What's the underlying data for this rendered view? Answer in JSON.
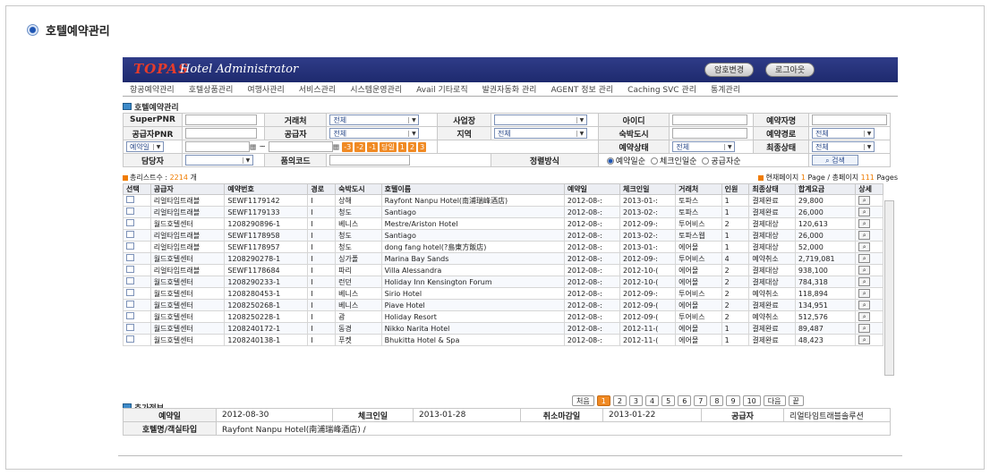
{
  "page": {
    "title": "호텔예약관리"
  },
  "banner": {
    "logo": "TOPAS",
    "subtitle": "Hotel Administrator",
    "change_password": "암호변경",
    "logout": "로그아웃"
  },
  "nav": [
    "항공예약관리",
    "호텔상품관리",
    "여행사관리",
    "서비스관리",
    "시스템운영관리",
    "Avail 기타로직",
    "발권자동화 관리",
    "AGENT 정보 관리",
    "Caching SVC 관리",
    "통계관리"
  ],
  "search": {
    "section_title": "호텔예약관리",
    "superpnr": "SuperPNR",
    "account": "거래처",
    "account_val": "전체",
    "business": "사업장",
    "user_id": "아이디",
    "booker": "예약자명",
    "supplier_pnr": "공급자PNR",
    "supplier": "공급자",
    "supplier_val": "전체",
    "region": "지역",
    "region_val": "전체",
    "city": "숙박도시",
    "route": "예약경로",
    "route_val": "전체",
    "date_type": "예약일",
    "tilde": "~",
    "quick": [
      "-3",
      "-2",
      "-1",
      "당일",
      "1",
      "2",
      "3"
    ],
    "status": "예약상태",
    "status_val": "전체",
    "final_status": "최종상태",
    "final_status_val": "전체",
    "manager": "담당자",
    "item_code": "품의코드",
    "sort": "정렬방식",
    "sort_options": [
      "예약일순",
      "체크인일순",
      "공급자순"
    ],
    "search_btn": "검색"
  },
  "list": {
    "count_label": "총리스트수 :",
    "count": "2214",
    "count_unit": "개",
    "page_label": "현재페이지",
    "page_cur": "1",
    "page_total_label": "Page / 총페이지",
    "page_total": "111",
    "pages_word": "Pages",
    "columns": [
      "선택",
      "공급자",
      "예약번호",
      "경로",
      "숙박도시",
      "호텔이름",
      "예약일",
      "체크인일",
      "거래처",
      "인원",
      "최종상태",
      "합계요금",
      "상세"
    ],
    "rows": [
      [
        "리얼타임트래블",
        "SEWF1179142",
        "I",
        "상해",
        "Rayfont Nanpu Hotel(南浦瑞峰酒店)",
        "2012-08-:",
        "2013-01-:",
        "토파스",
        "1",
        "결제완료",
        "29,800"
      ],
      [
        "리얼타임트래블",
        "SEWF1179133",
        "I",
        "청도",
        "Santiago",
        "2012-08-:",
        "2013-02-:",
        "토파스",
        "1",
        "결제완료",
        "26,000"
      ],
      [
        "월드호텔센터",
        "1208290896-1",
        "I",
        "베니스",
        "Mestre/Ariston Hotel",
        "2012-08-:",
        "2012-09-:",
        "투어비스",
        "2",
        "결제대상",
        "120,613"
      ],
      [
        "리얼타임트래블",
        "SEWF1178958",
        "I",
        "청도",
        "Santiago",
        "2012-08-:",
        "2013-02-:",
        "토파스웹",
        "1",
        "결제대상",
        "26,000"
      ],
      [
        "리얼타임트래블",
        "SEWF1178957",
        "I",
        "청도",
        "dong fang hotel(?島東方飯店)",
        "2012-08-:",
        "2013-01-:",
        "에어몰",
        "1",
        "결제대상",
        "52,000"
      ],
      [
        "월드호텔센터",
        "1208290278-1",
        "I",
        "싱가폴",
        "Marina Bay Sands",
        "2012-08-:",
        "2012-09-:",
        "투어비스",
        "4",
        "예약취소",
        "2,719,081"
      ],
      [
        "리얼타임트래블",
        "SEWF1178684",
        "I",
        "파리",
        "Villa Alessandra",
        "2012-08-:",
        "2012-10-(",
        "에어몰",
        "2",
        "결제대상",
        "938,100"
      ],
      [
        "월드호텔센터",
        "1208290233-1",
        "I",
        "런던",
        "Holiday Inn Kensington Forum",
        "2012-08-:",
        "2012-10-(",
        "에어몰",
        "2",
        "결제대상",
        "784,318"
      ],
      [
        "월드호텔센터",
        "1208280453-1",
        "I",
        "베니스",
        "Sirio Hotel",
        "2012-08-:",
        "2012-09-:",
        "투어비스",
        "2",
        "예약취소",
        "118,894"
      ],
      [
        "월드호텔센터",
        "1208250268-1",
        "I",
        "베니스",
        "Piave Hotel",
        "2012-08-:",
        "2012-09-(",
        "에어몰",
        "2",
        "결제완료",
        "134,951"
      ],
      [
        "월드호텔센터",
        "1208250228-1",
        "I",
        "괌",
        "Holiday Resort",
        "2012-08-:",
        "2012-09-(",
        "투어비스",
        "2",
        "예약취소",
        "512,576"
      ],
      [
        "월드호텔센터",
        "1208240172-1",
        "I",
        "동경",
        "Nikko Narita Hotel",
        "2012-08-:",
        "2012-11-(",
        "에어몰",
        "1",
        "결제완료",
        "89,487"
      ],
      [
        "월드호텔센터",
        "1208240138-1",
        "I",
        "푸켓",
        "Bhukitta Hotel & Spa",
        "2012-08-:",
        "2012-11-(",
        "에어몰",
        "1",
        "결제완료",
        "48,423"
      ]
    ],
    "pager": [
      "처음",
      "1",
      "2",
      "3",
      "4",
      "5",
      "6",
      "7",
      "8",
      "9",
      "10",
      "다음",
      "끝"
    ]
  },
  "extra": {
    "section_title": "추가정보",
    "booking_date_label": "예약일",
    "booking_date": "2012-08-30",
    "checkin_label": "체크인일",
    "checkin": "2013-01-28",
    "cancel_deadline_label": "취소마감일",
    "cancel_deadline": "2013-01-22",
    "supplier_label": "공급자",
    "supplier": "리얼타임트래블솔루션",
    "hotel_room_label": "호텔명/객실타입",
    "hotel_room": "Rayfont Nanpu Hotel(南浦瑞峰酒店)  /"
  }
}
